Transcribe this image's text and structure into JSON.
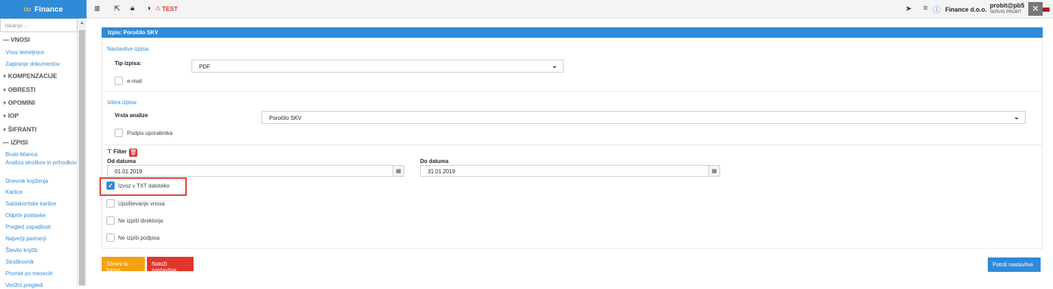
{
  "topbar": {
    "brand": "Finance",
    "test_label": "TEST",
    "company": "Finance d.o.o.",
    "user_name": "probit@pb5",
    "user_org": "SERVIS PROBIT",
    "close": "✕"
  },
  "sidebar": {
    "search_placeholder": "Iskanje...",
    "items": [
      {
        "type": "section",
        "label": "VNOSI",
        "sign": "—"
      },
      {
        "type": "link",
        "label": "Vnos temeljnice"
      },
      {
        "type": "link",
        "label": "Zapiranje dokumentov"
      },
      {
        "type": "section",
        "label": "KOMPENZACIJE",
        "sign": "+"
      },
      {
        "type": "section",
        "label": "OBRESTI",
        "sign": "+"
      },
      {
        "type": "section",
        "label": "OPOMINI",
        "sign": "+"
      },
      {
        "type": "section",
        "label": "IOP",
        "sign": "+"
      },
      {
        "type": "section",
        "label": "ŠIFRANTI",
        "sign": "+"
      },
      {
        "type": "section",
        "label": "IZPISI",
        "sign": "—"
      },
      {
        "type": "link",
        "label": "Bruto bilanca"
      },
      {
        "type": "link",
        "label": "Analiza stroškov in prihodkov"
      },
      {
        "type": "link",
        "label": "Dnevnik knjiženja"
      },
      {
        "type": "link",
        "label": "Kartice"
      },
      {
        "type": "link",
        "label": "Saldakontske kartice"
      },
      {
        "type": "link",
        "label": "Odprte postavke"
      },
      {
        "type": "link",
        "label": "Pregled zapadlosti"
      },
      {
        "type": "link",
        "label": "Največji partnerji"
      },
      {
        "type": "link",
        "label": "Število knjižb"
      },
      {
        "type": "link",
        "label": "Stroškovnik"
      },
      {
        "type": "link",
        "label": "Promet po mesecih"
      },
      {
        "type": "link",
        "label": "Verižni pregledi"
      }
    ]
  },
  "panel": {
    "title": "Izpis: Poročilo SKV",
    "output_settings": {
      "title": "Nastavitve izpisa:",
      "type_label": "Tip izpisa:",
      "type_value": "PDF",
      "email_label": "e-mail"
    },
    "report_select": {
      "title": "Izbira izpisa:",
      "analysis_label": "Vrsta analize",
      "analysis_value": "Poročilo SKV",
      "signature_label": "Podpis uporabnika"
    },
    "filter": {
      "label": "Filter",
      "from_label": "Od datuma",
      "from_value": "01.01.2019",
      "to_label": "Do datuma",
      "to_value": "31.01.2019",
      "options": [
        {
          "label": "Izvoz v TXT datoteko",
          "checked": true
        },
        {
          "label": "Upoštevanje vnosa",
          "checked": false
        },
        {
          "label": "Ne izpiši direktorja",
          "checked": false
        },
        {
          "label": "Ne izpiši podpisa",
          "checked": false
        }
      ]
    }
  },
  "buttons": {
    "save_form": "Shrani to formo",
    "load_settings": "Naloži nastavitve",
    "confirm": "Potrdi nastavitve"
  },
  "colors": {
    "accent": "#2f8ad8",
    "danger": "#e0362c",
    "warning": "#f2a20c"
  }
}
